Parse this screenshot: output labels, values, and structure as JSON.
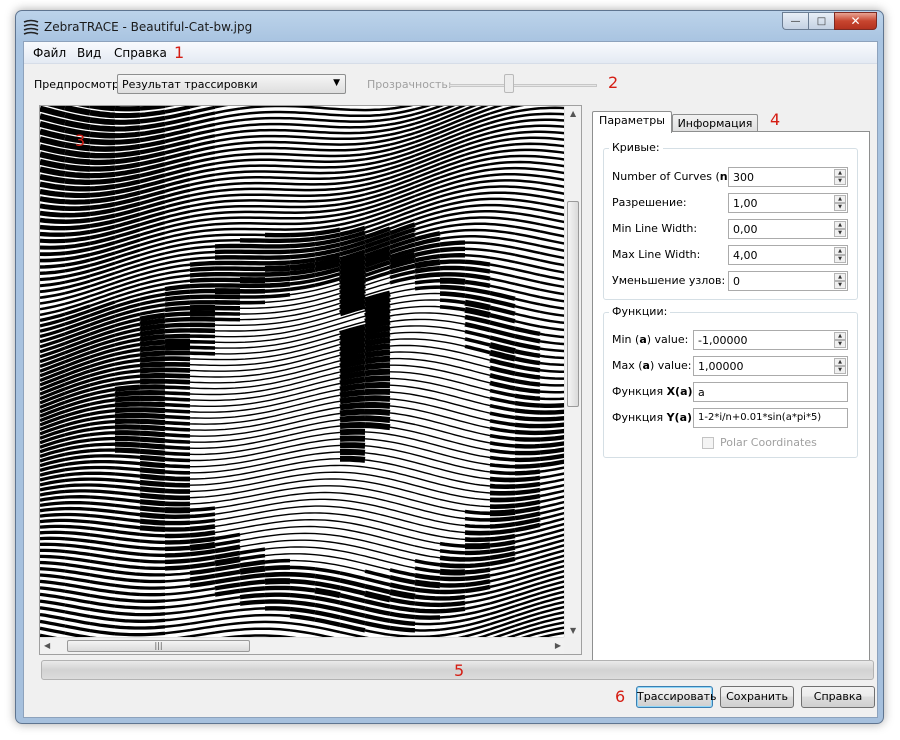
{
  "window": {
    "title": "ZebraTRACE - Beautiful-Cat-bw.jpg",
    "controls": {
      "minimize": "—",
      "maximize": "□",
      "close": "✕"
    }
  },
  "menu": {
    "items": [
      "Файл",
      "Вид",
      "Справка"
    ]
  },
  "toolbar": {
    "preview_label": "Предпросмотр:",
    "preview_value": "Результат трассировки",
    "transparency_label": "Прозрачность:",
    "transparency_value": 0.4
  },
  "scrollbars": {
    "hthumb_grip": "|||"
  },
  "tabs": [
    {
      "label": "Параметры",
      "active": true
    },
    {
      "label": "Информация",
      "active": false
    }
  ],
  "curves": {
    "title": "Кривые:",
    "number_label_pre": "Number of Curves (",
    "number_label_bold": "n",
    "number_label_post": "):",
    "number_value": "300",
    "resolution_label": "Разрешение:",
    "resolution_value": "1,00",
    "min_width_label": "Min Line Width:",
    "min_width_value": "0,00",
    "max_width_label": "Max Line Width:",
    "max_width_value": "4,00",
    "reduce_label": "Уменьшение узлов:",
    "reduce_value": "0"
  },
  "functions": {
    "title": "Функции:",
    "min_a_pre": "Min (",
    "min_a_bold": "a",
    "min_a_post": ") value:",
    "min_a_value": "-1,00000",
    "max_a_pre": "Max (",
    "max_a_bold": "a",
    "max_a_post": ") value:",
    "max_a_value": "1,00000",
    "xa_pre": "Функция ",
    "xa_bold": "X(a):",
    "xa_value": "a",
    "ya_pre": "Функция ",
    "ya_bold": "Y(a):",
    "ya_value": "1-2*i/n+0.01*sin(a*pi*5)",
    "polar_label": "Polar Coordinates",
    "polar_checked": false
  },
  "progress": {
    "value": 0
  },
  "buttons": {
    "trace": "Трассировать",
    "save": "Сохранить",
    "help": "Справка"
  },
  "annotations": [
    "1",
    "2",
    "3",
    "4",
    "5",
    "6"
  ],
  "colors": {
    "annotation": "#d51d13",
    "title_bar": "#bcd3ea",
    "default_button_border": "#3c7fb1"
  }
}
